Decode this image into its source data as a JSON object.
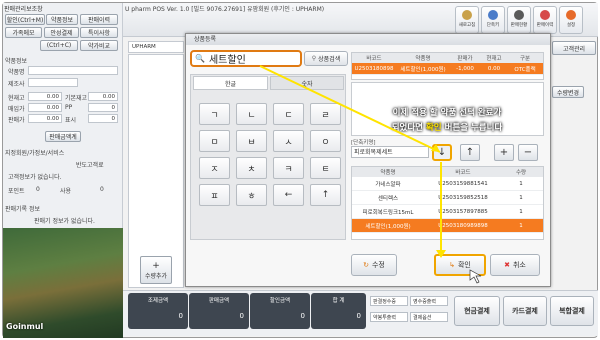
{
  "app": {
    "title": "U pharm POS Ver. 1.0 [빌드 9076.27691] 유팜회원 (후기인 : UPHARM)",
    "watermark": "Goinmul"
  },
  "left_panel": {
    "title": "판매관리보조창",
    "buttons_row1": [
      "할인(Ctrl+M)",
      "약품정보",
      "판매이력"
    ],
    "buttons_row2": [
      "가족메모",
      "안성결제",
      "특이사항"
    ],
    "buttons_row3": [
      "(Ctrl+C)",
      "약가비교"
    ],
    "section_info": "약품정보",
    "fields": [
      {
        "label": "약품명",
        "value": ""
      },
      {
        "label": "제조사",
        "value": ""
      },
      {
        "label": "현재고",
        "value": "0.00"
      },
      {
        "label": "매입가",
        "value": "0.00"
      },
      {
        "label": "판매가",
        "value": "0.00"
      }
    ],
    "fields_right": [
      {
        "label": "기본재고",
        "value": "0.00"
      },
      {
        "label": "PP",
        "value": "0"
      },
      {
        "label": "표시",
        "value": "0"
      }
    ],
    "check_label": "판매금액계",
    "section_customer": "지정회원/가정보/서비스",
    "customer_check": "반도고객료",
    "customer_text": "고객정보가 없습니다.",
    "points": [
      {
        "label": "포인트",
        "value": "0"
      },
      {
        "label": "사용",
        "value": "0"
      }
    ],
    "history_label": "판매기록 정보",
    "history_text": "판매기 정보가 없습니다."
  },
  "toolbar": {
    "buttons": [
      "새로고침",
      "단축키",
      "판매현황",
      "판매이력",
      "설정"
    ],
    "customer_button": "고객관리",
    "upharm_tag": "UPHARM",
    "edit_qty": "수량변경"
  },
  "dialog": {
    "title": "상품등록",
    "search_value": "세트할인",
    "search_button": "상품검색",
    "kbd_tabs": [
      "한글",
      "숫자"
    ],
    "keys": [
      "ㄱ",
      "ㄴ",
      "ㄷ",
      "ㄹ",
      "ㅁ",
      "ㅂ",
      "ㅅ",
      "ㅇ",
      "ㅈ",
      "ㅊ",
      "ㅋ",
      "ㅌ",
      "ㅍ",
      "ㅎ",
      "←",
      "↑"
    ],
    "result_headers": [
      "바코드",
      "약품명",
      "판매가",
      "현재고",
      "구분"
    ],
    "result_row": [
      "U2503180898",
      "세트할인(1,000원)",
      "-1,000",
      "0.00",
      "OTC플랙"
    ],
    "unit_label": "[단축키명]",
    "unit_value": "피로회복제세트",
    "down_button": "↓",
    "up_button": "↑",
    "plus_button": "+",
    "minus_button": "−",
    "set_headers": [
      "약품명",
      "바코드",
      "수량"
    ],
    "set_rows": [
      [
        "가네스알파",
        "U2503159881541",
        "1"
      ],
      [
        "센티렉스",
        "U2503159852518",
        "1"
      ],
      [
        "피로회복드링크15mL",
        "U2503157897885",
        "1"
      ],
      [
        "세트할인(1,000원)",
        "U2503180989898",
        "1"
      ]
    ],
    "edit_button": "수정",
    "confirm_button": "확인",
    "cancel_button": "취소",
    "annotation_line1": "이제 적용 할 약품 선택 완료가",
    "annotation_line2_pre": "되었다면 ",
    "annotation_highlight": "확인",
    "annotation_line2_post": " 버튼을 누릅니다",
    "add_button": "수량추가"
  },
  "bottom": {
    "labels": [
      "조제금액",
      "판매금액",
      "할인금액",
      "합 계"
    ],
    "values": [
      "0",
      "0",
      "0",
      "0"
    ],
    "checks": [
      "판결정수증",
      "영수증출력",
      "약봉투출력",
      "결제옵션"
    ],
    "buttons": [
      "현금결제",
      "카드결제",
      "복합결제"
    ]
  },
  "colors": {
    "accent": "#f57b20",
    "highlight_box": "#f0a500",
    "arrow": "#ffe400"
  }
}
